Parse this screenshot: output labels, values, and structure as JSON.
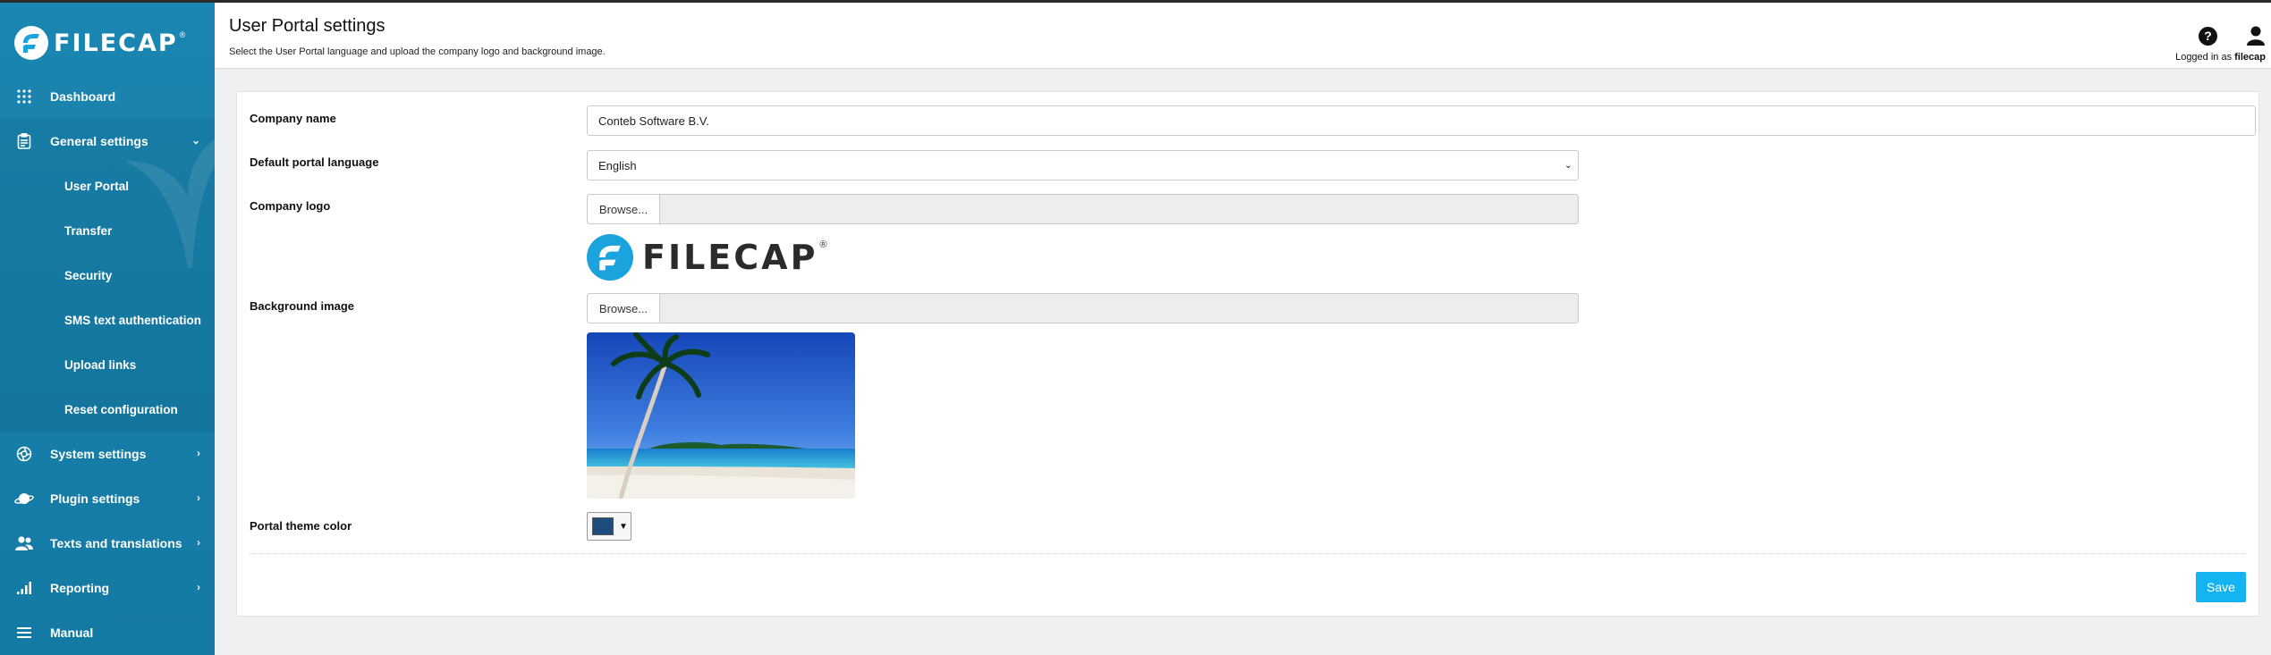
{
  "brand": {
    "name": "FILECAP",
    "registered": "®"
  },
  "colors": {
    "sidebar": "#1885b0",
    "accent": "#14b4f2",
    "theme_swatch": "#1d4c7d"
  },
  "sidebar": {
    "items": [
      {
        "label": "Dashboard",
        "icon": "grid-icon"
      },
      {
        "label": "General settings",
        "icon": "clipboard-icon",
        "expanded": true,
        "children": [
          "User Portal",
          "Transfer",
          "Security",
          "SMS text authentication",
          "Upload links",
          "Reset configuration"
        ]
      },
      {
        "label": "System settings",
        "icon": "aperture-icon"
      },
      {
        "label": "Plugin settings",
        "icon": "planet-icon"
      },
      {
        "label": "Texts and translations",
        "icon": "users-icon"
      },
      {
        "label": "Reporting",
        "icon": "bar-chart-icon"
      },
      {
        "label": "Manual",
        "icon": "menu-icon"
      }
    ]
  },
  "header": {
    "title": "User Portal settings",
    "subtitle": "Select the User Portal language and upload the company logo and background image.",
    "help": "?",
    "logged_in_prefix": "Logged in as ",
    "username": "filecap"
  },
  "form": {
    "company_name_label": "Company name",
    "company_name_value": "Conteb Software B.V.",
    "language_label": "Default portal language",
    "language_value": "English",
    "logo_label": "Company logo",
    "browse_label": "Browse...",
    "background_label": "Background image",
    "theme_label": "Portal theme color",
    "save_label": "Save"
  }
}
